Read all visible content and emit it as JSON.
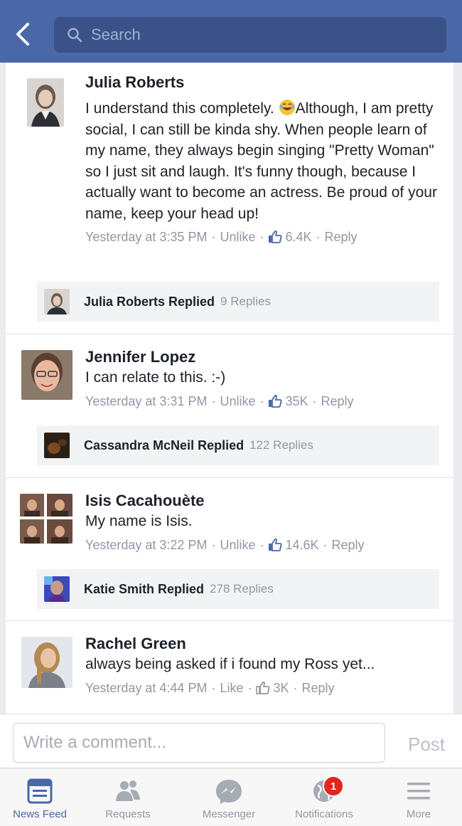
{
  "header": {
    "search_placeholder": "Search"
  },
  "comments": [
    {
      "name": "Julia Roberts",
      "text_before_emoji": "I understand this completely. ",
      "text_after_emoji": "Although, I am pretty social, I can still be kinda shy. When people learn of my name, they always begin singing \"Pretty Woman\" so I just sit and laugh. It's funny though, because I actually want to become an actress. Be proud of your name, keep your head up!",
      "time": "Yesterday at 3:35 PM",
      "like_action": "Unlike",
      "likes": "6.4K",
      "reply_action": "Reply",
      "reply_summary": {
        "name": "Julia Roberts",
        "verb": "Replied",
        "count": "9 Replies"
      }
    },
    {
      "name": "Jennifer Lopez",
      "text": "I can relate to this. :-)",
      "time": "Yesterday at 3:31 PM",
      "like_action": "Unlike",
      "likes": "35K",
      "reply_action": "Reply",
      "reply_summary": {
        "name": "Cassandra McNeil",
        "verb": "Replied",
        "count": "122 Replies"
      }
    },
    {
      "name": "Isis Cacahouète",
      "text": "My name is Isis.",
      "time": "Yesterday at 3:22 PM",
      "like_action": "Unlike",
      "likes": "14.6K",
      "reply_action": "Reply",
      "reply_summary": {
        "name": "Katie Smith",
        "verb": "Replied",
        "count": "278 Replies"
      }
    },
    {
      "name": "Rachel Green",
      "text": "always being asked if i found my Ross yet...",
      "time": "Yesterday at 4:44 PM",
      "like_action": "Like",
      "likes": "3K",
      "reply_action": "Reply"
    }
  ],
  "composer": {
    "placeholder": "Write a comment...",
    "post_label": "Post"
  },
  "tabs": [
    {
      "label": "News Feed",
      "icon": "news-feed-icon",
      "active": true
    },
    {
      "label": "Requests",
      "icon": "requests-icon"
    },
    {
      "label": "Messenger",
      "icon": "messenger-icon"
    },
    {
      "label": "Notifications",
      "icon": "notifications-icon",
      "badge": "1"
    },
    {
      "label": "More",
      "icon": "more-icon"
    }
  ],
  "colors": {
    "brand": "#4a67a8",
    "meta_gray": "#9197a3",
    "badge_red": "#e1261c"
  }
}
